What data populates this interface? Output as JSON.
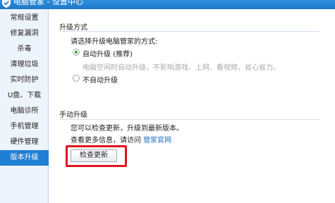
{
  "window": {
    "title": "电脑管家 - 设置中心"
  },
  "sidebar": {
    "items": [
      {
        "label": "常规设置"
      },
      {
        "label": "修复漏洞"
      },
      {
        "label": "杀毒"
      },
      {
        "label": "清理垃圾"
      },
      {
        "label": "实时防护"
      },
      {
        "label": "U盘、下载"
      },
      {
        "label": "电脑诊所"
      },
      {
        "label": "手机管理"
      },
      {
        "label": "硬件管理"
      },
      {
        "label": "版本升级",
        "active": true
      }
    ]
  },
  "upgrade_method": {
    "title": "升级方式",
    "prompt": "请选择升级电脑管家的方式:",
    "options": [
      {
        "label": "自动升级 (推荐)",
        "selected": true,
        "description": "电脑空闲时自动升级，不影响游戏、上网、看视频，省心省力。"
      },
      {
        "label": "不自动升级",
        "selected": false
      }
    ]
  },
  "manual_upgrade": {
    "title": "手动升级",
    "description": "您可以检查更新，升级到最新版本。",
    "more_info_prefix": "查看更多信息，请访问",
    "more_info_link": "管家官网",
    "check_button": "检查更新"
  },
  "colors": {
    "accent": "#1f7fd4",
    "highlight": "#e0141e",
    "radio_selected": "#2aa12a"
  },
  "icons": {
    "title": "shield-icon"
  }
}
